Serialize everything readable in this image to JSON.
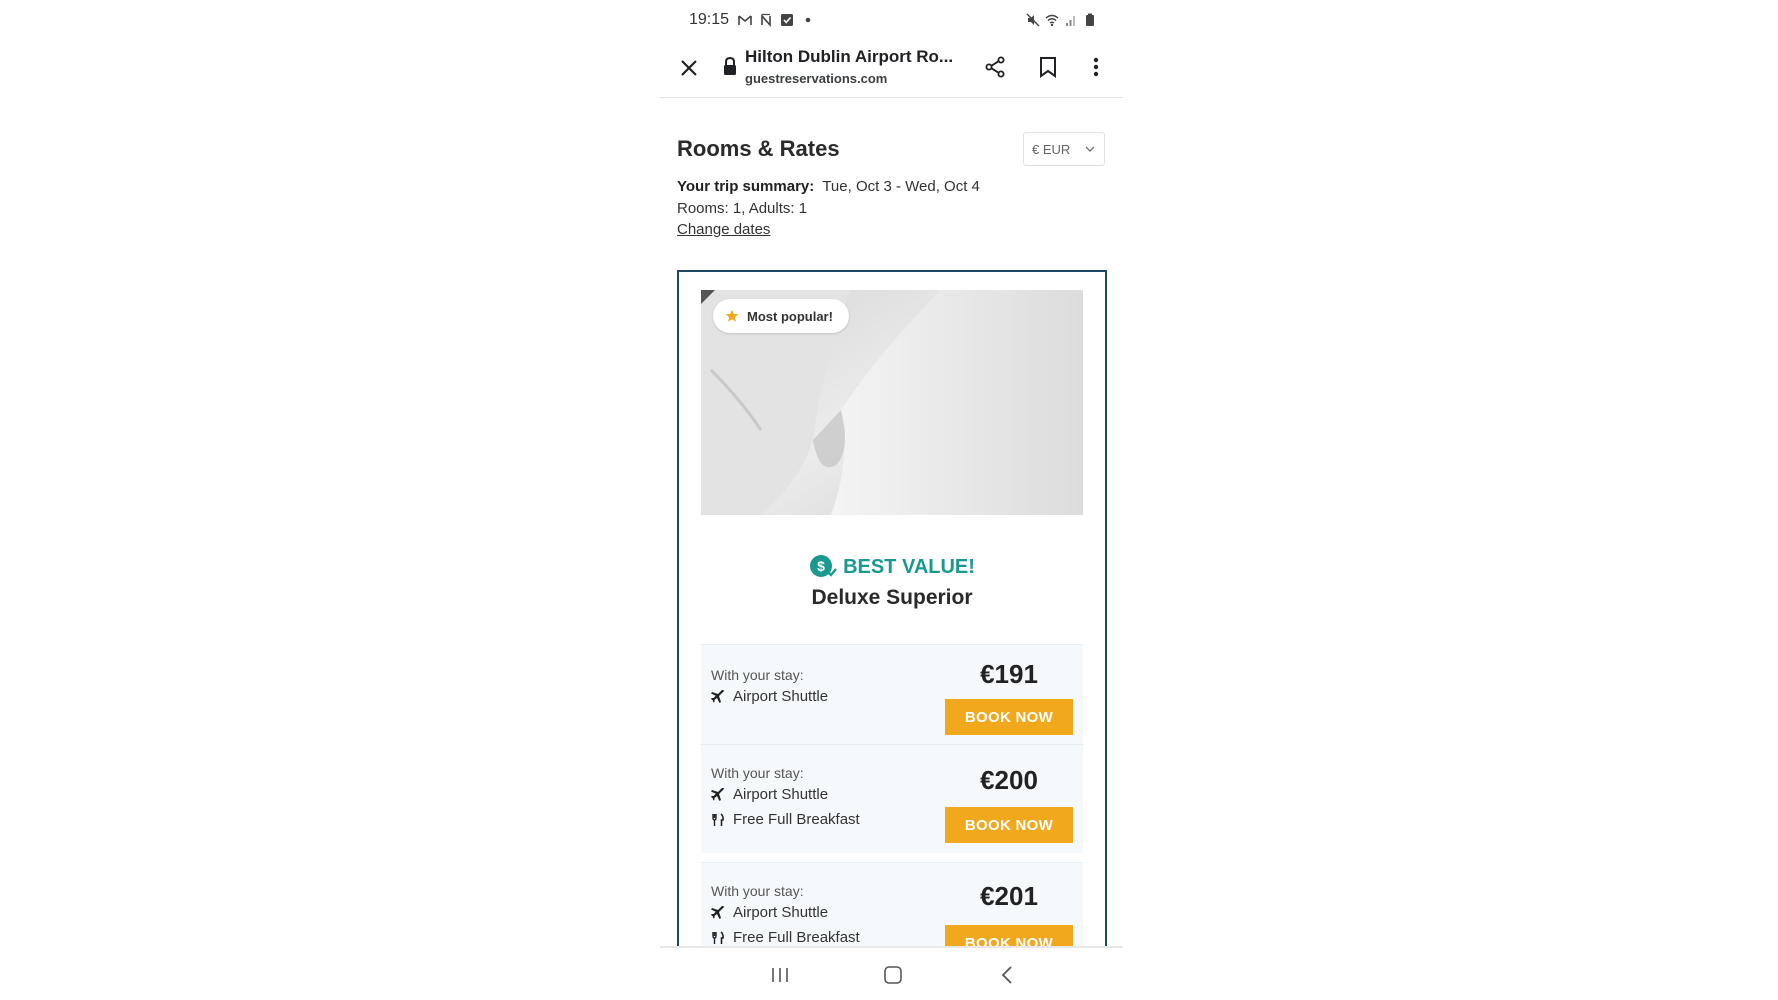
{
  "status_bar": {
    "time": "19:15",
    "left_icons": [
      "gmail-icon",
      "n-icon",
      "checkbox-icon",
      "dot-icon"
    ],
    "right_icons": [
      "mute-icon",
      "wifi-icon",
      "signal-icon",
      "battery-icon"
    ]
  },
  "toolbar": {
    "title": "Hilton Dublin Airport Ro...",
    "url": "guestreservations.com"
  },
  "page": {
    "title": "Rooms & Rates",
    "currency": "€ EUR",
    "trip_label": "Your trip summary:",
    "trip_dates": "Tue, Oct 3 - Wed, Oct 4",
    "trip_occupancy": "Rooms: 1, Adults: 1",
    "change_dates": "Change dates"
  },
  "room": {
    "badge": "Most popular!",
    "best_value": "BEST VALUE!",
    "name": "Deluxe Superior",
    "rates": [
      {
        "with_label": "With your stay:",
        "amenities": [
          "Airport Shuttle"
        ],
        "price": "€191",
        "button": "BOOK NOW"
      },
      {
        "with_label": "With your stay:",
        "amenities": [
          "Airport Shuttle",
          "Free Full Breakfast"
        ],
        "price": "€200",
        "button": "BOOK NOW"
      },
      {
        "with_label": "With your stay:",
        "amenities": [
          "Airport Shuttle",
          "Free Full Breakfast"
        ],
        "price": "€201",
        "button": "BOOK NOW"
      }
    ]
  },
  "colors": {
    "accent_teal": "#1a9a8e",
    "book_button": "#f2a81d",
    "card_border": "#1d4a63"
  }
}
